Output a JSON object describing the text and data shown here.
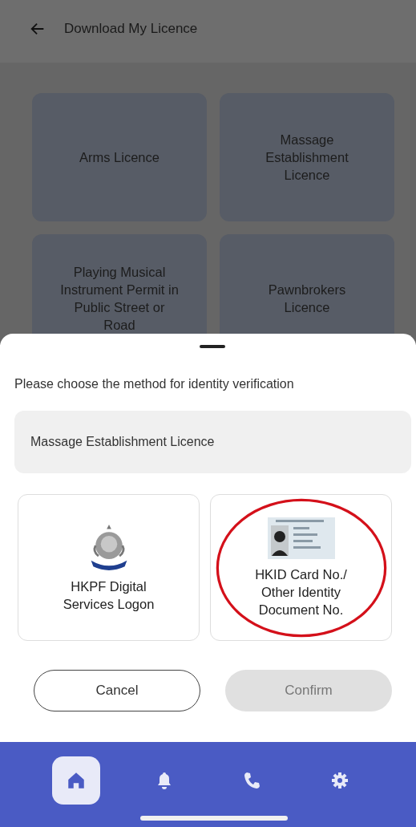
{
  "header": {
    "title": "Download My Licence"
  },
  "licences": [
    {
      "label": "Arms Licence"
    },
    {
      "label": "Massage Establishment Licence"
    },
    {
      "label": "Playing Musical Instrument Permit in Public Street or Road"
    },
    {
      "label": "Pawnbrokers Licence"
    }
  ],
  "sheet": {
    "prompt": "Please choose the method for identity verification",
    "licence_field": {
      "value": "Massage Establishment Licence"
    },
    "methods": [
      {
        "kind": "logon",
        "label": "HKPF Digital Services Logon",
        "circled": false
      },
      {
        "kind": "idcard",
        "label": "HKID Card No./ Other Identity Document No.",
        "circled": true
      }
    ],
    "buttons": [
      {
        "kind": "outline",
        "label": "Cancel",
        "disabled": false
      },
      {
        "kind": "filled",
        "label": "Confirm",
        "disabled": true
      }
    ]
  },
  "nav": [
    {
      "kind": "home",
      "selected": true
    },
    {
      "kind": "bell",
      "selected": false
    },
    {
      "kind": "phone",
      "selected": false
    },
    {
      "kind": "gear",
      "selected": false
    }
  ]
}
